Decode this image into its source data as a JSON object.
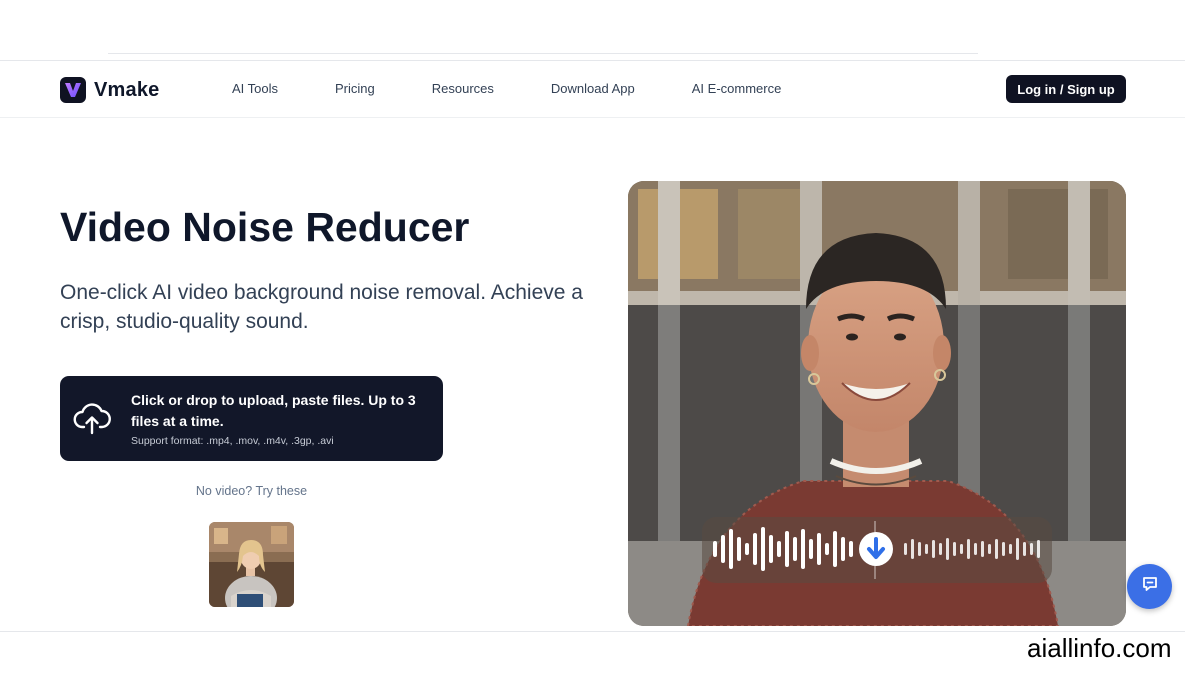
{
  "header": {
    "brand": "Vmake",
    "nav": [
      "AI Tools",
      "Pricing",
      "Resources",
      "Download App",
      "AI E-commerce"
    ],
    "login_label": "Log in / Sign up"
  },
  "hero": {
    "title": "Video Noise Reducer",
    "subtitle": "One-click AI video background noise removal. Achieve a crisp, studio-quality sound."
  },
  "upload": {
    "main_text": "Click or drop to upload, paste files. Up to 3 files at a time.",
    "formats": "Support format: .mp4, .mov, .m4v, .3gp, .avi",
    "icon": "cloud-upload-icon"
  },
  "samples": {
    "label": "No video? Try these"
  },
  "icons": {
    "logo": "vmake-logo-icon",
    "chat": "chat-icon",
    "download": "arrow-down-icon"
  },
  "colors": {
    "dark": "#121729",
    "accent_blue": "#3b6fe6"
  },
  "watermark": "aiallinfo.com"
}
